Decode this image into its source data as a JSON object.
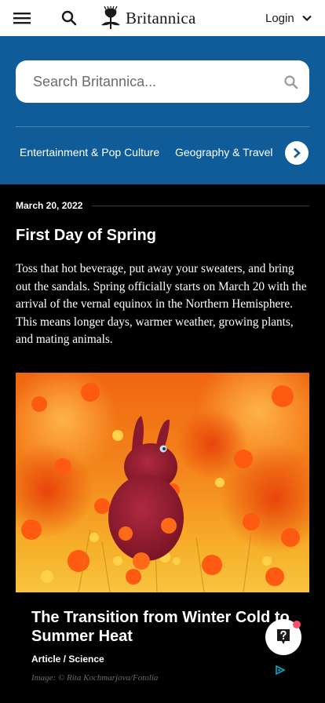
{
  "header": {
    "menu_icon": "hamburger-menu-icon",
    "search_icon": "search-icon",
    "logo_text": "Britannica",
    "login_label": "Login",
    "login_icon": "chevron-down-icon"
  },
  "search": {
    "placeholder": "Search Britannica...",
    "submit_icon": "search-icon"
  },
  "categories": {
    "items": [
      {
        "label": "Entertainment & Pop Culture"
      },
      {
        "label": "Geography & Travel"
      }
    ],
    "next_icon": "chevron-right-icon"
  },
  "article": {
    "date": "March 20, 2022",
    "title": "First Day of Spring",
    "body": "Toss that hot beverage, put away your sweaters, and bring out the sandals. Spring officially starts on March 20 with the arrival of the vernal equinox in the Northern Hemisphere. This means longer days, warmer weather, growing plants, and mating animals."
  },
  "card": {
    "title": "The Transition from Winter Cold to Summer Heat",
    "meta": "Article / Science",
    "credit": "Image: © Rita Kochmarjova/Fotolia"
  },
  "colors": {
    "hero_bg": "#0f5c99",
    "page_bg": "#000000",
    "help_badge": "#ff4f6d"
  },
  "floating": {
    "help_icon": "question-mark-icon",
    "ad_icon": "ad-choices-icon"
  }
}
